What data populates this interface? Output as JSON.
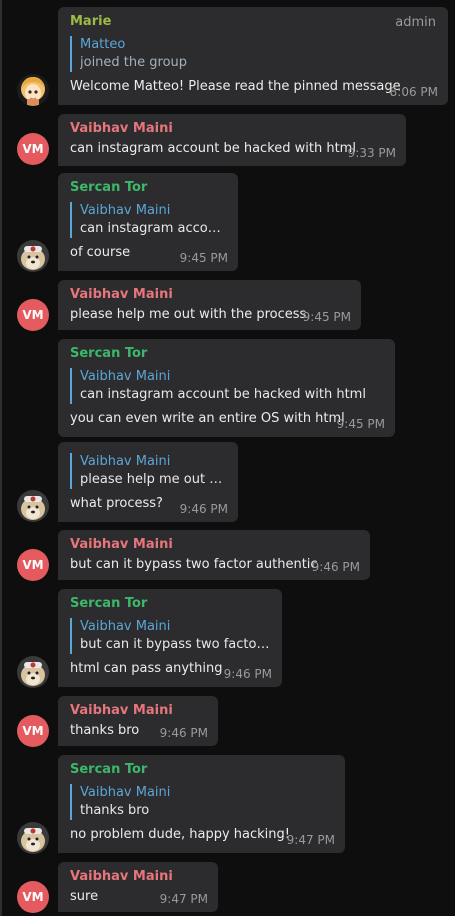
{
  "colors": {
    "marie": "#9dbb45",
    "vaibhav": "#e5767b",
    "sercan": "#3cb86b",
    "reply": "#5ba6d8",
    "vm_avatar": "#e35a5f",
    "bubble": "#2c2c2e"
  },
  "avatars": {
    "vm_initials": "VM"
  },
  "messages": [
    {
      "sender": "Marie",
      "badge": "admin",
      "reply_author": "Matteo",
      "reply_text": "joined the group",
      "text": "Welcome Matteo! Please read the pinned message",
      "time": "8:06 PM"
    },
    {
      "sender": "Vaibhav Maini",
      "text": "can instagram account be hacked with html",
      "time": "9:33 PM"
    },
    {
      "sender": "Sercan Tor",
      "reply_author": "Vaibhav Maini",
      "reply_text": "can instagram accoun…",
      "text": "of course",
      "time": "9:45 PM"
    },
    {
      "sender": "Vaibhav Maini",
      "text": "please help me out with the process",
      "time": "9:45 PM"
    },
    {
      "sender": "Sercan Tor",
      "reply_author": "Vaibhav Maini",
      "reply_text": "can instagram account be hacked with html",
      "text": "you can even write an entire OS with html",
      "time": "9:45 PM"
    },
    {
      "reply_author": "Vaibhav Maini",
      "reply_text": "please help me out wi…",
      "text": "what process?",
      "time": "9:46 PM"
    },
    {
      "sender": "Vaibhav Maini",
      "text": "but can it bypass two factor authentic",
      "time": "9:46 PM"
    },
    {
      "sender": "Sercan Tor",
      "reply_author": "Vaibhav Maini",
      "reply_text": "but can it bypass two factor a…",
      "text": "html can pass anything",
      "time": "9:46 PM"
    },
    {
      "sender": "Vaibhav Maini",
      "text": "thanks bro",
      "time": "9:46 PM"
    },
    {
      "sender": "Sercan Tor",
      "reply_author": "Vaibhav Maini",
      "reply_text": "thanks bro",
      "text": "no problem dude, happy hacking!",
      "time": "9:47 PM"
    },
    {
      "sender": "Vaibhav Maini",
      "text": "sure",
      "time": "9:47 PM"
    }
  ]
}
